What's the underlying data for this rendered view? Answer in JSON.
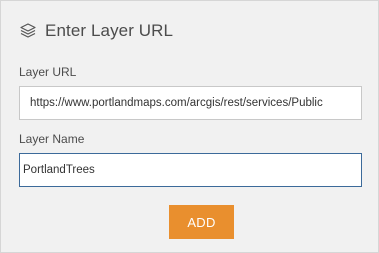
{
  "header": {
    "icon": "layers-icon",
    "title": "Enter Layer URL"
  },
  "form": {
    "url_label": "Layer URL",
    "url_value": "https://www.portlandmaps.com/arcgis/rest/services/Public",
    "name_label": "Layer Name",
    "name_value": "PortlandTrees"
  },
  "actions": {
    "add_label": "ADD"
  },
  "colors": {
    "panel_bg": "#f1f1f1",
    "accent_button": "#e98f2e",
    "focused_border": "#3c6a9a"
  }
}
